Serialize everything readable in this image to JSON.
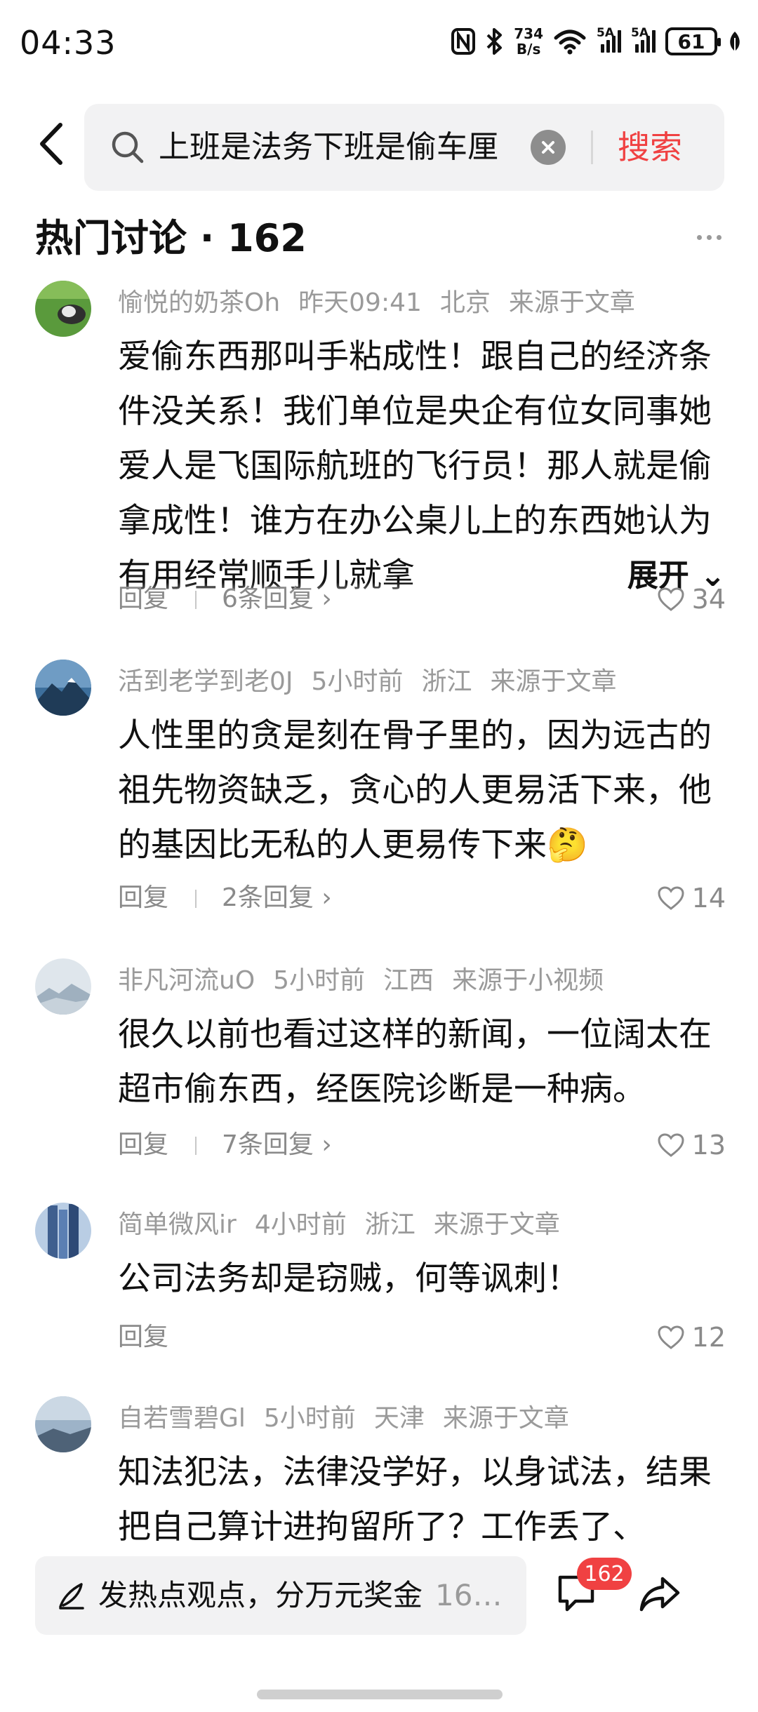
{
  "status_bar": {
    "time": "04:33",
    "net_speed_value": "734",
    "net_speed_unit": "B/s",
    "sim1_tag": "5A",
    "sim2_tag": "5A",
    "battery": "61"
  },
  "search": {
    "query": "上班是法务下班是偷车厘",
    "button_label": "搜索"
  },
  "section": {
    "title": "热门讨论 · 162"
  },
  "comments": [
    {
      "username": "愉悦的奶茶Oh",
      "time": "昨天09:41",
      "location": "北京",
      "source": "来源于文章",
      "text": "爱偷东西那叫手粘成性！跟自己的经济条件没关系！我们单位是央企有位女同事她爱人是飞国际航班的飞行员！那人就是偷拿成性！谁方在办公桌儿上的东西她认为有用经常顺手儿就拿",
      "expand_label": "展开 ⌄",
      "reply_label": "回复",
      "replies": "6条回复 ›",
      "likes": "34"
    },
    {
      "username": "活到老学到老0J",
      "time": "5小时前",
      "location": "浙江",
      "source": "来源于文章",
      "text": "人性里的贪是刻在骨子里的，因为远古的祖先物资缺乏，贪心的人更易活下来，他的基因比无私的人更易传下来🤔",
      "reply_label": "回复",
      "replies": "2条回复 ›",
      "likes": "14"
    },
    {
      "username": "非凡河流uO",
      "time": "5小时前",
      "location": "江西",
      "source": "来源于小视频",
      "text": "很久以前也看过这样的新闻，一位阔太在超市偷东西，经医院诊断是一种病。",
      "reply_label": "回复",
      "replies": "7条回复 ›",
      "likes": "13"
    },
    {
      "username": "简单微风ir",
      "time": "4小时前",
      "location": "浙江",
      "source": "来源于文章",
      "text": "公司法务却是窃贼，何等讽刺！",
      "reply_label": "回复",
      "likes": "12"
    },
    {
      "username": "自若雪碧Gl",
      "time": "5小时前",
      "location": "天津",
      "source": "来源于文章",
      "text": "知法犯法，法律没学好，以身试法，结果把自己算计进拘留所了？工作丢了、"
    }
  ],
  "bottom_bar": {
    "compose_placeholder": "发热点观点，分万元奖金",
    "compose_count": "16…",
    "comment_badge": "162"
  },
  "colors": {
    "accent_red": "#f04142",
    "meta_gray": "#9a9a9a",
    "search_bg": "#f2f2f3"
  },
  "icons": [
    "back-arrow-icon",
    "search-icon",
    "clear-icon",
    "more-icon",
    "heart-icon",
    "pen-icon",
    "comment-icon",
    "share-icon",
    "nfc-icon",
    "bluetooth-icon",
    "wifi-icon",
    "signal-icon",
    "battery-icon",
    "leaf-icon"
  ]
}
